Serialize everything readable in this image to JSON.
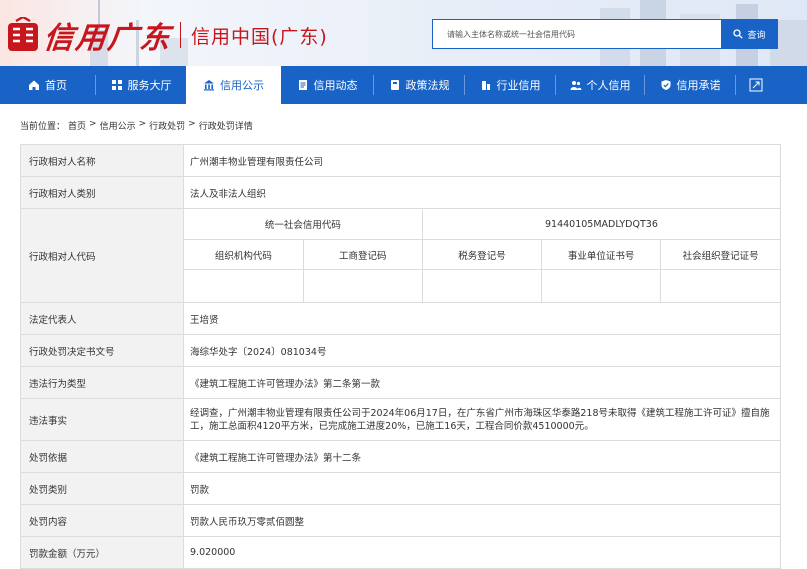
{
  "header": {
    "logo_text": "信用广东",
    "site_name": "信用中国(广东)",
    "search_placeholder": "请输入主体名称或统一社会信用代码",
    "search_button": "查询",
    "brand_color": "#c8161d",
    "accent_color": "#1a63c6"
  },
  "nav": {
    "items": [
      {
        "label": "首页",
        "icon": "home-icon"
      },
      {
        "label": "服务大厅",
        "icon": "grid-icon"
      },
      {
        "label": "信用公示",
        "icon": "bank-icon",
        "active": true
      },
      {
        "label": "信用动态",
        "icon": "document-icon"
      },
      {
        "label": "政策法规",
        "icon": "book-icon"
      },
      {
        "label": "行业信用",
        "icon": "building-icon"
      },
      {
        "label": "个人信用",
        "icon": "people-icon"
      },
      {
        "label": "信用承诺",
        "icon": "shield-check-icon"
      }
    ],
    "expand_icon": "expand-icon"
  },
  "breadcrumb": {
    "prefix": "当前位置：",
    "items": [
      "首页",
      "信用公示",
      "行政处罚",
      "行政处罚详情"
    ],
    "separator": ">"
  },
  "detail": {
    "rows": {
      "name": {
        "label": "行政相对人名称",
        "value": "广州潮丰物业管理有限责任公司"
      },
      "category": {
        "label": "行政相对人类别",
        "value": "法人及非法人组织"
      },
      "codes": {
        "label": "行政相对人代码",
        "uscc_label": "统一社会信用代码",
        "uscc_value": "91440105MADLYDQT36",
        "headers": [
          "组织机构代码",
          "工商登记码",
          "税务登记号",
          "事业单位证书号",
          "社会组织登记证号"
        ],
        "values": [
          "",
          "",
          "",
          "",
          ""
        ]
      },
      "legal_rep": {
        "label": "法定代表人",
        "value": "王培贤"
      },
      "doc_no": {
        "label": "行政处罚决定书文号",
        "value": "海综华处字〔2024〕081034号"
      },
      "violation_type": {
        "label": "违法行为类型",
        "value": "《建筑工程施工许可管理办法》第二条第一款"
      },
      "facts": {
        "label": "违法事实",
        "value": "经调查，广州潮丰物业管理有限责任公司于2024年06月17日，在广东省广州市海珠区华泰路218号未取得《建筑工程施工许可证》擅自施工，施工总面积4120平方米，已完成施工进度20%，已施工16天，工程合同价款4510000元。"
      },
      "basis": {
        "label": "处罚依据",
        "value": "《建筑工程施工许可管理办法》第十二条"
      },
      "penalty_category": {
        "label": "处罚类别",
        "value": "罚款"
      },
      "penalty_content": {
        "label": "处罚内容",
        "value": "罚款人民币玖万零贰佰圆整"
      },
      "fine_amount": {
        "label": "罚款金额（万元）",
        "value": "9.020000"
      }
    }
  }
}
